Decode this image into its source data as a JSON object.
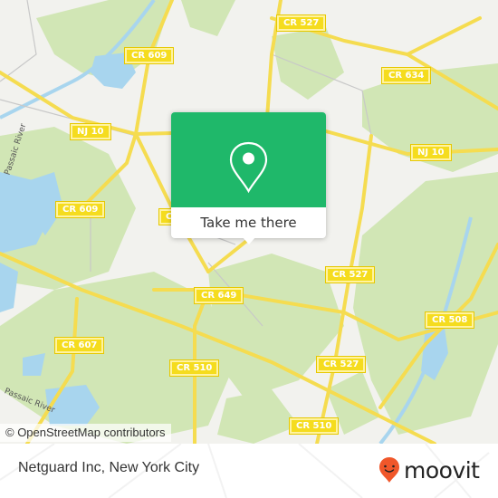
{
  "map": {
    "attribution": "© OpenStreetMap contributors",
    "colors": {
      "land": "#f2f2ee",
      "park": "#d1e6b5",
      "water": "#a8d5ee",
      "road_major": "#f5dc50",
      "road_minor": "#c8c8c8"
    },
    "road_labels": [
      {
        "text": "CR 527",
        "name": "road-label-cr-527-north"
      },
      {
        "text": "CR 609",
        "name": "road-label-cr-609-north"
      },
      {
        "text": "CR 634",
        "name": "road-label-cr-634"
      },
      {
        "text": "NJ 10",
        "name": "road-label-nj-10-west"
      },
      {
        "text": "NJ 10",
        "name": "road-label-nj-10-east"
      },
      {
        "text": "CR 609",
        "name": "road-label-cr-609-south"
      },
      {
        "text": "CR",
        "name": "road-label-cr-partial"
      },
      {
        "text": "CR 527",
        "name": "road-label-cr-527-middle"
      },
      {
        "text": "CR 649",
        "name": "road-label-cr-649"
      },
      {
        "text": "CR 508",
        "name": "road-label-cr-508"
      },
      {
        "text": "CR 607",
        "name": "road-label-cr-607"
      },
      {
        "text": "CR 510",
        "name": "road-label-cr-510-west"
      },
      {
        "text": "CR 527",
        "name": "road-label-cr-527-south"
      },
      {
        "text": "CR 510",
        "name": "road-label-cr-510-south"
      }
    ],
    "place_labels": [
      {
        "text": "Passaic River",
        "name": "place-label-passaic-river-north"
      },
      {
        "text": "Passaic River",
        "name": "place-label-passaic-river-south"
      }
    ]
  },
  "popup": {
    "icon": "map-pin-icon",
    "button_label": "Take me there",
    "accent_color": "#1fb86a"
  },
  "footer": {
    "title": "Netguard Inc, New York City",
    "brand": "moovit",
    "brand_icon": "moovit-pin-logo-icon",
    "brand_color": "#f0572a"
  }
}
